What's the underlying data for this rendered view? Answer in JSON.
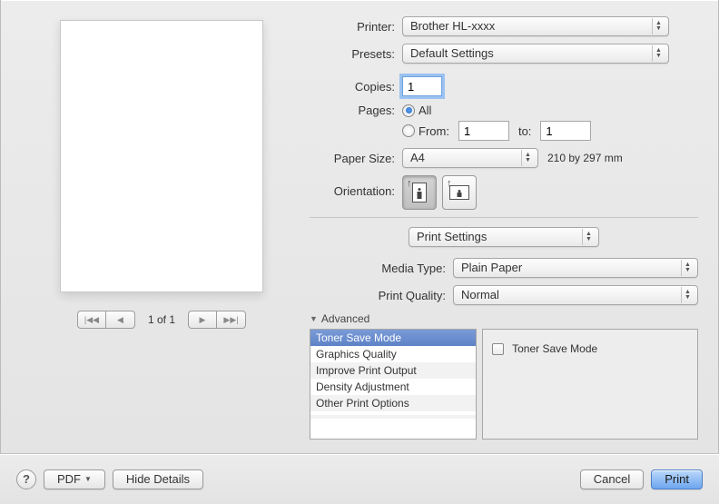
{
  "labels": {
    "printer": "Printer:",
    "presets": "Presets:",
    "copies": "Copies:",
    "pages": "Pages:",
    "from": "From:",
    "to": "to:",
    "paperSize": "Paper Size:",
    "orientation": "Orientation:",
    "mediaType": "Media Type:",
    "printQuality": "Print Quality:",
    "advanced": "Advanced"
  },
  "values": {
    "printer": "Brother HL-xxxx",
    "presets": "Default Settings",
    "copies": "1",
    "pagesMode": "All",
    "fromPage": "1",
    "toPage": "1",
    "paperSize": "A4",
    "paperDims": "210 by 297 mm",
    "section": "Print Settings",
    "mediaType": "Plain Paper",
    "printQuality": "Normal"
  },
  "pager": {
    "label": "1 of 1"
  },
  "advancedList": [
    "Toner Save Mode",
    "Graphics Quality",
    "Improve Print Output",
    "Density Adjustment",
    "Other Print Options"
  ],
  "advancedPanel": {
    "tonerSaveLabel": "Toner Save Mode"
  },
  "footer": {
    "pdf": "PDF",
    "hideDetails": "Hide Details",
    "cancel": "Cancel",
    "print": "Print"
  }
}
